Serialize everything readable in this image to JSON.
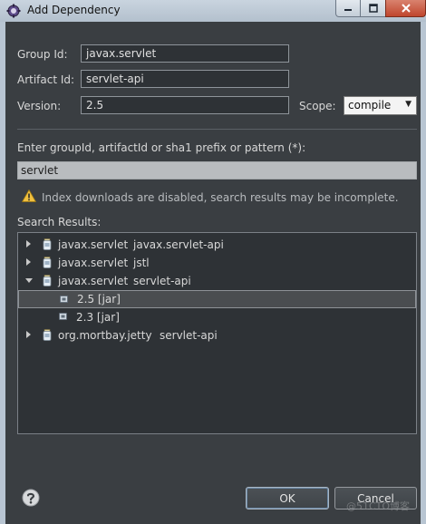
{
  "window": {
    "title": "Add Dependency"
  },
  "form": {
    "group_id_label": "Group Id:",
    "group_id_value": "javax.servlet",
    "artifact_id_label": "Artifact Id:",
    "artifact_id_value": "servlet-api",
    "version_label": "Version:",
    "version_value": "2.5",
    "scope_label": "Scope:",
    "scope_value": "compile"
  },
  "search": {
    "prompt_label": "Enter groupId, artifactId or sha1 prefix or pattern (*):",
    "query": "servlet",
    "warning": "Index downloads are disabled, search results may be incomplete.",
    "results_label": "Search Results:",
    "results": [
      {
        "group": "javax.servlet",
        "artifact": "javax.servlet-api",
        "expanded": false
      },
      {
        "group": "javax.servlet",
        "artifact": "jstl",
        "expanded": false
      },
      {
        "group": "javax.servlet",
        "artifact": "servlet-api",
        "expanded": true,
        "versions": [
          {
            "label": "2.5 [jar]",
            "selected": true
          },
          {
            "label": "2.3 [jar]",
            "selected": false
          }
        ]
      },
      {
        "group": "org.mortbay.jetty",
        "artifact": "servlet-api",
        "expanded": false
      }
    ]
  },
  "buttons": {
    "ok": "OK",
    "cancel": "Cancel"
  },
  "watermark": "@51CTO博客",
  "icons": {
    "app": "eclipse-gear-icon",
    "warning": "warning-triangle-icon",
    "help": "help-question-icon",
    "jar": "jar-icon",
    "version": "version-chip-icon"
  },
  "colors": {
    "panel_bg": "#3a3e42",
    "field_bg": "#2e3236",
    "selected_row": "#4a4d50",
    "warning": "#f0c040"
  }
}
